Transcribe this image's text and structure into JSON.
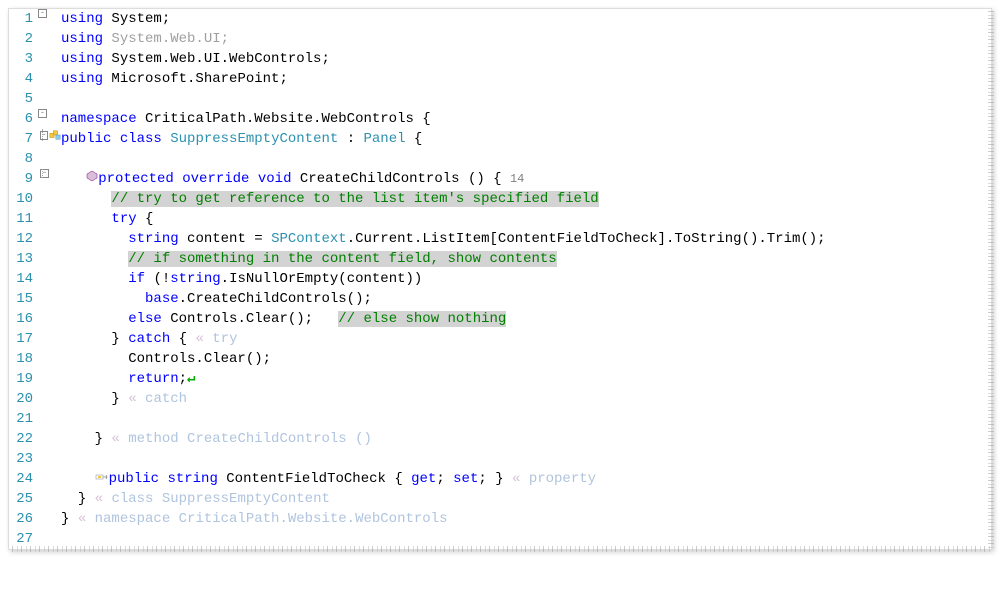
{
  "colors": {
    "keyword": "#0000ff",
    "type": "#2b91af",
    "comment": "#008000",
    "comment_bg": "#d3d3d3",
    "dim": "#a0a0a0",
    "ghost": "#b0c4de"
  },
  "lines": {
    "1": {
      "ln": "1"
    },
    "2": {
      "ln": "2"
    },
    "3": {
      "ln": "3"
    },
    "4": {
      "ln": "4"
    },
    "5": {
      "ln": "5"
    },
    "6": {
      "ln": "6"
    },
    "7": {
      "ln": "7"
    },
    "8": {
      "ln": "8"
    },
    "9": {
      "ln": "9"
    },
    "10": {
      "ln": "10"
    },
    "11": {
      "ln": "11"
    },
    "12": {
      "ln": "12"
    },
    "13": {
      "ln": "13"
    },
    "14": {
      "ln": "14"
    },
    "15": {
      "ln": "15"
    },
    "16": {
      "ln": "16"
    },
    "17": {
      "ln": "17"
    },
    "18": {
      "ln": "18"
    },
    "19": {
      "ln": "19"
    },
    "20": {
      "ln": "20"
    },
    "21": {
      "ln": "21"
    },
    "22": {
      "ln": "22"
    },
    "23": {
      "ln": "23"
    },
    "24": {
      "ln": "24"
    },
    "25": {
      "ln": "25"
    },
    "26": {
      "ln": "26"
    },
    "27": {
      "ln": "27"
    }
  },
  "tok": {
    "using": "using",
    "namespace": "namespace",
    "public": "public",
    "class": "class",
    "protected": "protected",
    "override": "override",
    "void": "void",
    "try": "try",
    "string_kw": "string",
    "if": "if",
    "base": "base",
    "else": "else",
    "catch": "catch",
    "return": "return",
    "get": "get",
    "set": "set",
    "system": "System",
    "system_web_ui": "System.Web.UI",
    "system_web_ui_web": "System.Web.UI.WebControls",
    "ms_sp": "Microsoft.SharePoint",
    "ns_name": "CriticalPath.Website.WebControls",
    "class_name": "SuppressEmptyContent",
    "panel": "Panel",
    "createchild": "CreateChildControls",
    "complexity": "14",
    "c_tryget": "// try to get reference to the list item's specified field",
    "content_var": "content",
    "spcontext": "SPContext",
    "current_listitem": ".Current.ListItem[ContentFieldToCheck].ToString().Trim();",
    "c_ifsome": "// if something in the content field, show contents",
    "isnullorempty": ".IsNullOrEmpty(content))",
    "base_create": ".CreateChildControls();",
    "controls_clear": "Controls.Clear();",
    "c_elseshow": "// else show nothing",
    "marker": "«",
    "gh_try": "try",
    "gh_catch": "catch",
    "gh_method": "method CreateChildControls ()",
    "contentfield": "ContentFieldToCheck",
    "gh_property": "property",
    "gh_class": "class SuppressEmptyContent",
    "gh_namespace": "namespace CriticalPath.Website.WebControls",
    "semicolon": ";",
    "brace_open": "{",
    "brace_close": "}",
    "colon": ":",
    "paren": "()",
    "excl_open": "(!",
    "sp1": " ",
    "sp3": "   ",
    "sp4": "    ",
    "sp5": "     ",
    "sp6": "      ",
    "sp7": "       ",
    "sp8": "        ",
    "eq": " = ",
    "arrow": "↵"
  }
}
